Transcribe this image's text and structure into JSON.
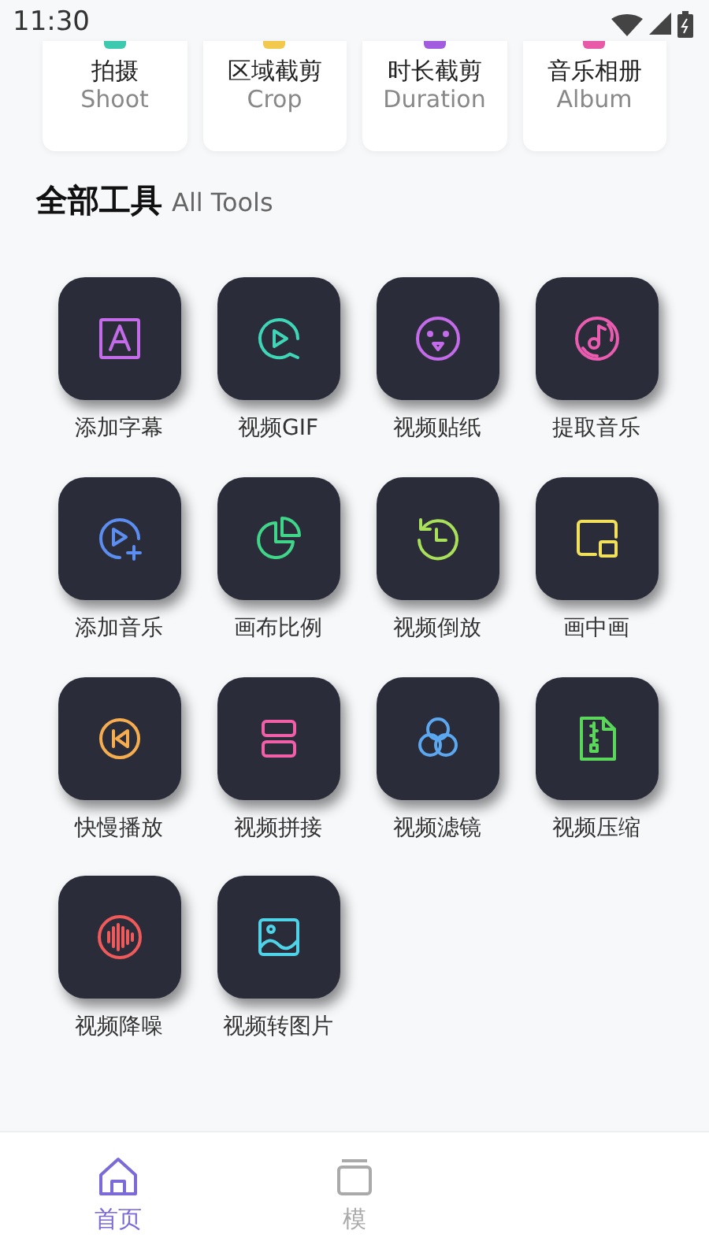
{
  "status_bar": {
    "time": "11:30"
  },
  "quick_tools": [
    {
      "title": "拍摄",
      "subtitle": "Shoot",
      "color": "#3cc9b0"
    },
    {
      "title": "区域截剪",
      "subtitle": "Crop",
      "color": "#f2c94c"
    },
    {
      "title": "时长截剪",
      "subtitle": "Duration",
      "color": "#a25ce0"
    },
    {
      "title": "音乐相册",
      "subtitle": "Album",
      "color": "#e85aa8"
    }
  ],
  "section": {
    "title": "全部工具",
    "subtitle": "All Tools"
  },
  "tools": [
    {
      "label": "添加字幕",
      "kind": "text",
      "color": "#c36be8"
    },
    {
      "label": "视频GIF",
      "kind": "gif",
      "color": "#3fd6b8"
    },
    {
      "label": "视频贴纸",
      "kind": "face",
      "color": "#c36be8"
    },
    {
      "label": "提取音乐",
      "kind": "music",
      "color": "#e95cb0"
    },
    {
      "label": "添加音乐",
      "kind": "playadd",
      "color": "#5b8ef0"
    },
    {
      "label": "画布比例",
      "kind": "pie",
      "color": "#3fd68a"
    },
    {
      "label": "视频倒放",
      "kind": "replay",
      "color": "#a8e05a"
    },
    {
      "label": "画中画",
      "kind": "pip",
      "color": "#f2e05a"
    },
    {
      "label": "快慢播放",
      "kind": "back",
      "color": "#f5ad4f"
    },
    {
      "label": "视频拼接",
      "kind": "split",
      "color": "#f05fa8"
    },
    {
      "label": "视频滤镜",
      "kind": "filter",
      "color": "#5ba8f0"
    },
    {
      "label": "视频压缩",
      "kind": "zip",
      "color": "#5ad65a"
    },
    {
      "label": "视频降噪",
      "kind": "wave",
      "color": "#f05a5a"
    },
    {
      "label": "视频转图片",
      "kind": "image",
      "color": "#4fd3e8"
    }
  ],
  "bottom_nav": [
    {
      "label": "首页",
      "kind": "home",
      "selected": true
    },
    {
      "label": "模",
      "kind": "box",
      "selected": false
    }
  ]
}
